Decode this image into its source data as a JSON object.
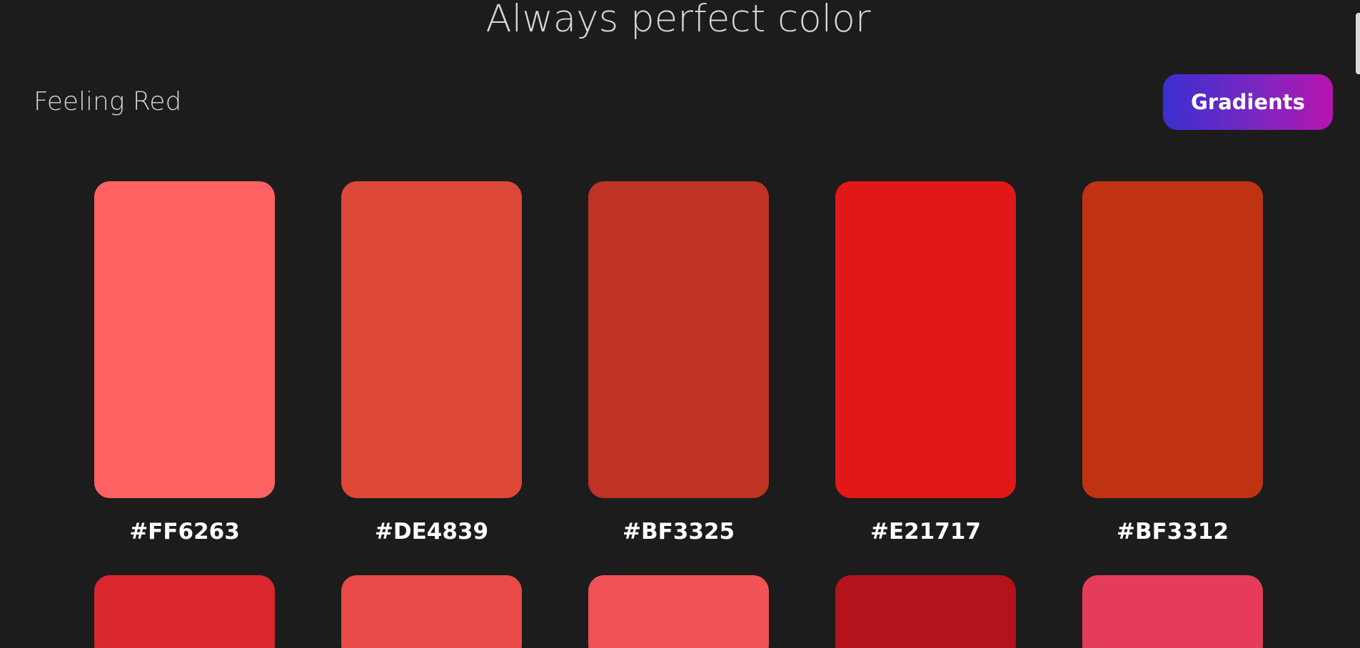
{
  "header": {
    "title": "Always perfect color"
  },
  "palette": {
    "name": "Feeling Red",
    "gradients_label": "Gradients"
  },
  "swatches": [
    {
      "hex": "#FF6263",
      "color": "#ff6263"
    },
    {
      "hex": "#DE4839",
      "color": "#de4839"
    },
    {
      "hex": "#BF3325",
      "color": "#bf3325"
    },
    {
      "hex": "#E21717",
      "color": "#e21717"
    },
    {
      "hex": "#BF3312",
      "color": "#bf3312"
    },
    {
      "hex": "",
      "color": "#d9272d"
    },
    {
      "hex": "",
      "color": "#e84b47"
    },
    {
      "hex": "",
      "color": "#ef5356"
    },
    {
      "hex": "",
      "color": "#b3141c"
    },
    {
      "hex": "",
      "color": "#e53c59"
    }
  ]
}
